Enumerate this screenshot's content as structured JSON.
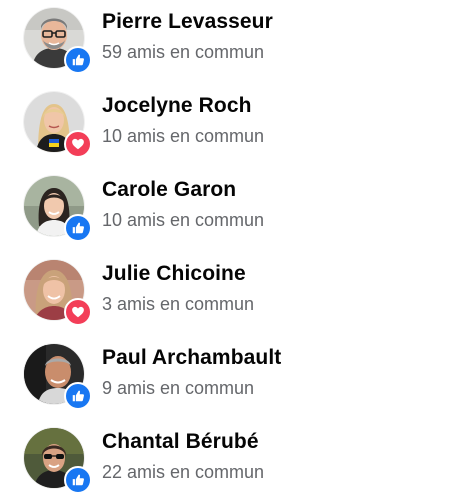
{
  "people": [
    {
      "name": "Pierre Levasseur",
      "mutual": "59 amis en commun",
      "reaction": "like-icon",
      "reaction_color": "#1877f2"
    },
    {
      "name": "Jocelyne Roch",
      "mutual": "10 amis en commun",
      "reaction": "love-icon",
      "reaction_color": "#f33e58"
    },
    {
      "name": "Carole Garon",
      "mutual": "10 amis en commun",
      "reaction": "like-icon",
      "reaction_color": "#1877f2"
    },
    {
      "name": "Julie Chicoine",
      "mutual": "3 amis en commun",
      "reaction": "love-icon",
      "reaction_color": "#f33e58"
    },
    {
      "name": "Paul Archambault",
      "mutual": "9 amis en commun",
      "reaction": "like-icon",
      "reaction_color": "#1877f2"
    },
    {
      "name": "Chantal Bérubé",
      "mutual": "22 amis en commun",
      "reaction": "like-icon",
      "reaction_color": "#1877f2"
    }
  ],
  "colors": {
    "name_text": "#050505",
    "secondary_text": "#65676b",
    "like_blue": "#1877f2",
    "love_red": "#f33e58"
  }
}
